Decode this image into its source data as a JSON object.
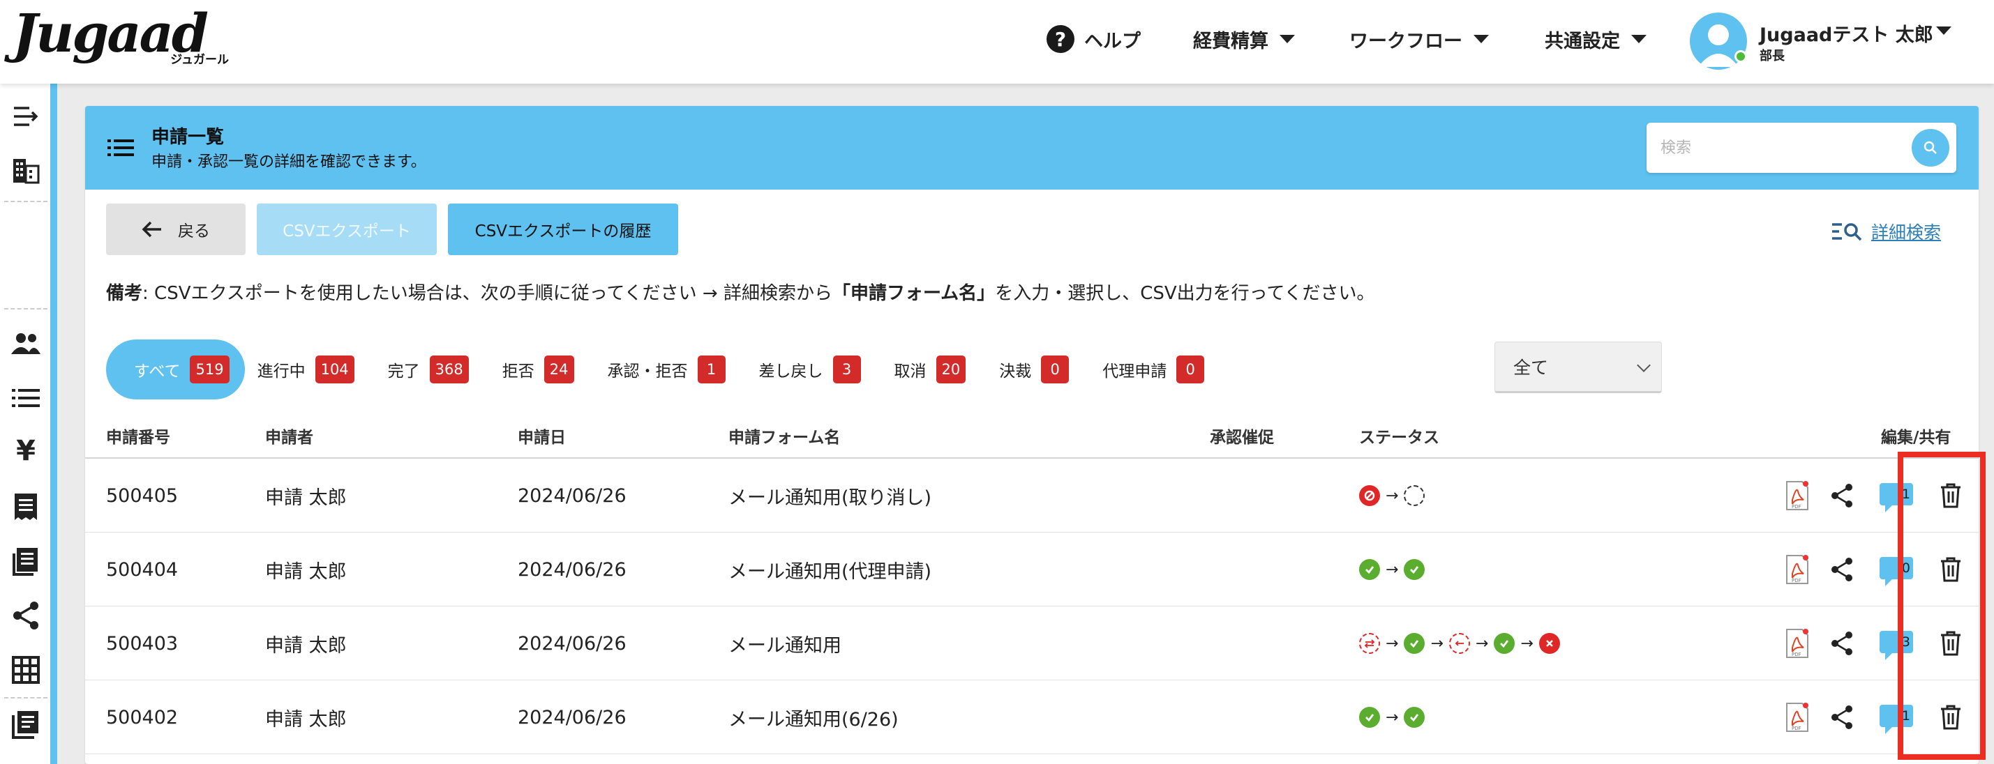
{
  "brand": {
    "logo_text": "Jugaad",
    "logo_sub": "ジュガール"
  },
  "nav": {
    "help": "ヘルプ",
    "items": [
      {
        "label": "経費精算"
      },
      {
        "label": "ワークフロー"
      },
      {
        "label": "共通設定"
      }
    ]
  },
  "user": {
    "name": "Jugaadテスト 太郎",
    "role": "部長"
  },
  "panel": {
    "title": "申請一覧",
    "subtitle": "申請・承認一覧の詳細を確認できます。",
    "search_placeholder": "検索"
  },
  "toolbar": {
    "back": "戻る",
    "csv_export": "CSVエクスポート",
    "csv_history": "CSVエクスポートの履歴",
    "advanced_search": "詳細検索"
  },
  "note": {
    "label": "備考",
    "text1": ":  CSVエクスポートを使用したい場合は、次の手順に従ってください → 詳細検索から",
    "bold": "「申請フォーム名」",
    "text2": "を入力・選択し、CSV出力を行ってください。"
  },
  "filters": [
    {
      "label": "すべて",
      "count": "519"
    },
    {
      "label": "進行中",
      "count": "104"
    },
    {
      "label": "完了",
      "count": "368"
    },
    {
      "label": "拒否",
      "count": "24"
    },
    {
      "label": "承認・拒否",
      "count": "1"
    },
    {
      "label": "差し戻し",
      "count": "3"
    },
    {
      "label": "取消",
      "count": "20"
    },
    {
      "label": "決裁",
      "count": "0"
    },
    {
      "label": "代理申請",
      "count": "0"
    }
  ],
  "select": {
    "value": "全て"
  },
  "columns": {
    "number": "申請番号",
    "applicant": "申請者",
    "date": "申請日",
    "form": "申請フォーム名",
    "reminder": "承認催促",
    "status": "ステータス",
    "edit_share": "編集/共有"
  },
  "rows": [
    {
      "number": "500405",
      "applicant": "申請 太郎",
      "date": "2024/06/26",
      "form": "メール通知用(取り消し)",
      "comments": "1"
    },
    {
      "number": "500404",
      "applicant": "申請 太郎",
      "date": "2024/06/26",
      "form": "メール通知用(代理申請)",
      "comments": "0"
    },
    {
      "number": "500403",
      "applicant": "申請 太郎",
      "date": "2024/06/26",
      "form": "メール通知用",
      "comments": "3"
    },
    {
      "number": "500402",
      "applicant": "申請 太郎",
      "date": "2024/06/26",
      "form": "メール通知用(6/26)",
      "comments": "1"
    }
  ],
  "colors": {
    "accent": "#5ec1f0",
    "badge": "#d32a2a",
    "ok": "#5aad2e",
    "ng": "#e02727",
    "highlight": "#ec2e22"
  },
  "icons": [
    "help-icon",
    "user-avatar",
    "menu-collapse-icon",
    "building-icon",
    "users-icon",
    "list-icon",
    "yen-icon",
    "receipt-icon",
    "ledger-icon",
    "share-icon",
    "grid-icon",
    "document-stack-icon",
    "search-icon",
    "arrow-left-icon",
    "advanced-search-icon",
    "pdf-icon",
    "comment-icon",
    "trash-icon"
  ]
}
